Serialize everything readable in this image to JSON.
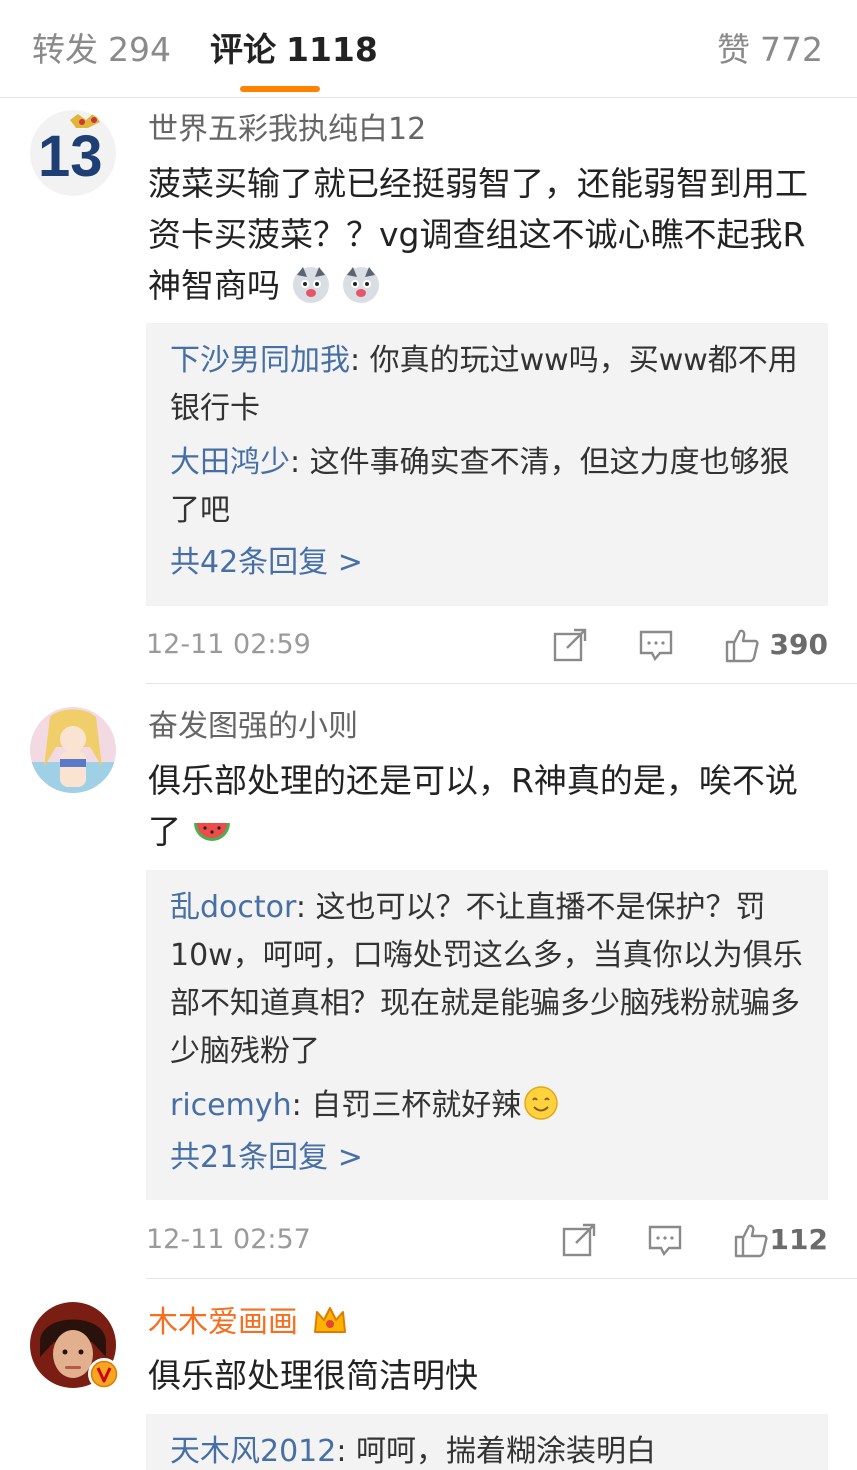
{
  "tabs": {
    "reposts": {
      "label": "转发",
      "count": "294"
    },
    "comments": {
      "label": "评论",
      "count": "1118"
    },
    "likes": {
      "label": "赞",
      "count": "772"
    }
  },
  "comments": [
    {
      "username": "世界五彩我执纯白12",
      "text": "菠菜买输了就已经挺弱智了，还能弱智到用工资卡买菠菜？？vg调查组这不诚心瞧不起我R神智商吗",
      "replies": [
        {
          "name": "下沙男同加我",
          "text": ": 你真的玩过ww吗，买ww都不用银行卡"
        },
        {
          "name": "大田鸿少",
          "text": ": 这件事确实查不清，但这力度也够狠了吧"
        }
      ],
      "more": "共42条回复 >",
      "time": "12-11 02:59",
      "likes": "390"
    },
    {
      "username": "奋发图强的小则",
      "text": "俱乐部处理的还是可以，R神真的是，唉不说了",
      "replies": [
        {
          "name": "乱doctor",
          "text": ": 这也可以？不让直播不是保护？罚10w，呵呵，口嗨处罚这么多，当真你以为俱乐部不知道真相？现在就是能骗多少脑残粉就骗多少脑残粉了"
        },
        {
          "name": "ricemyh",
          "text": ": 自罚三杯就好辣"
        }
      ],
      "more": "共21条回复 >",
      "time": "12-11 02:57",
      "likes": "112"
    },
    {
      "username": "木木爱画画",
      "text": "俱乐部处理很简洁明快",
      "replies": [
        {
          "name": "天木风2012",
          "text": ": 呵呵，揣着糊涂装明白"
        }
      ]
    }
  ],
  "icons": {
    "repost": "share-icon",
    "comment": "comment-icon",
    "like": "thumbs-up-icon"
  },
  "colors": {
    "accent": "#ff8200",
    "link": "#466fa6",
    "vip_name": "#f86e1f"
  }
}
